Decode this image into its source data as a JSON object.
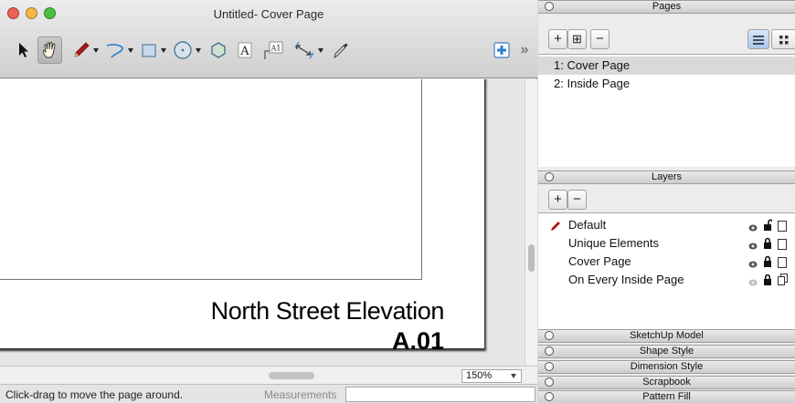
{
  "window": {
    "title": "Untitled- Cover Page",
    "traffic_lights": [
      "#ee5f56",
      "#f6b843",
      "#49c03f"
    ]
  },
  "toolbar": {
    "tools": [
      {
        "name": "select-tool",
        "icon": "arrow-cursor-icon"
      },
      {
        "name": "pan-tool",
        "icon": "hand-icon",
        "selected": true
      },
      {
        "name": "line-tool",
        "icon": "pencil-icon"
      },
      {
        "name": "arc-tool",
        "icon": "arc-icon"
      },
      {
        "name": "rectangle-tool",
        "icon": "rectangle-icon"
      },
      {
        "name": "circle-tool",
        "icon": "circle-icon"
      },
      {
        "name": "polygon-tool",
        "icon": "polygon-icon"
      },
      {
        "name": "text-tool",
        "icon": "text-icon"
      },
      {
        "name": "label-tool",
        "icon": "label-icon"
      },
      {
        "name": "dimension-tool",
        "icon": "dimension-icon"
      },
      {
        "name": "style-tool",
        "icon": "eyedropper-icon"
      },
      {
        "name": "add-page-tool",
        "icon": "add-page-icon"
      },
      {
        "name": "overflow-tool",
        "icon": "double-chevron-icon"
      }
    ],
    "text_icon_glyph": "A",
    "label_icon_glyph": "A1",
    "overflow_glyph": "»"
  },
  "document": {
    "elevation_title": "North Street Elevation",
    "sheet_number": "A.01"
  },
  "zoom": {
    "value": "150%"
  },
  "status": {
    "hint": "Click-drag to move the page around.",
    "measurements_label": "Measurements",
    "measurements_value": ""
  },
  "panels": {
    "pages": {
      "title": "Pages",
      "add_label": "+",
      "duplicate_label": "⊞",
      "remove_label": "−",
      "items": [
        {
          "label": "1: Cover Page",
          "selected": true
        },
        {
          "label": "2: Inside Page",
          "selected": false
        }
      ]
    },
    "layers": {
      "title": "Layers",
      "add_label": "+",
      "remove_label": "−",
      "items": [
        {
          "label": "Default",
          "active": true,
          "locked": false,
          "shared": false
        },
        {
          "label": "Unique Elements",
          "active": false,
          "locked": true,
          "shared": false
        },
        {
          "label": "Cover Page",
          "active": false,
          "locked": true,
          "shared": false
        },
        {
          "label": "On Every Inside Page",
          "active": false,
          "locked": true,
          "shared": true
        }
      ]
    },
    "collapsed": [
      "SketchUp Model",
      "Shape Style",
      "Dimension Style",
      "Scrapbook",
      "Pattern Fill"
    ]
  },
  "colors": {
    "selection_gray": "#d9d9d9",
    "pencil_red": "#b01818",
    "tool_blue": "#2a7fd4"
  }
}
